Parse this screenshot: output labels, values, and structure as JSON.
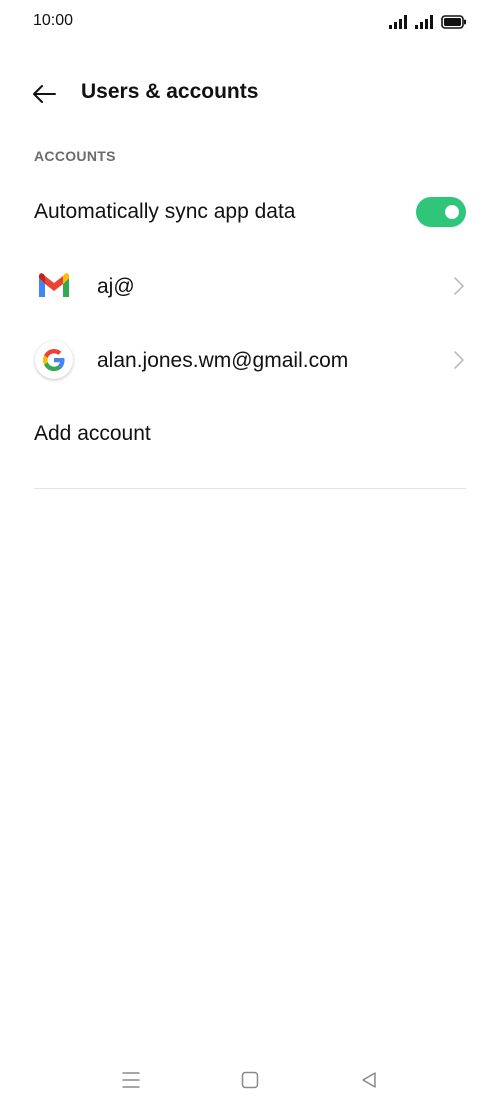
{
  "status_bar": {
    "time": "10:00",
    "icons": [
      "signal-icon",
      "signal-icon",
      "battery-icon"
    ]
  },
  "header": {
    "back_icon": "arrow-left-icon",
    "title": "Users & accounts"
  },
  "accounts_section": {
    "label": "ACCOUNTS",
    "auto_sync": {
      "label": "Automatically sync app data",
      "enabled": true,
      "toggle_color": "#2fc67a"
    },
    "accounts": [
      {
        "icon": "gmail-icon",
        "label": "aj@"
      },
      {
        "icon": "google-icon",
        "label": "alan.jones.wm@gmail.com"
      }
    ],
    "add_account_label": "Add account"
  },
  "nav_bar": {
    "buttons": [
      "menu-icon",
      "home-icon",
      "back-icon"
    ]
  }
}
